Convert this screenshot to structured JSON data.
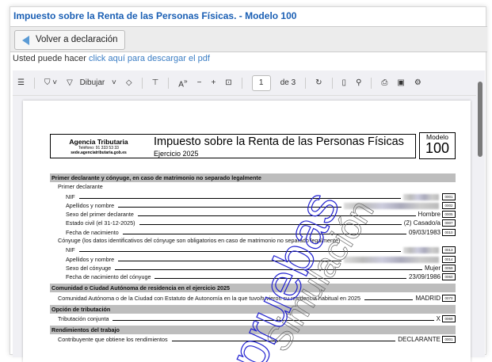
{
  "window": {
    "title": "Impuesto sobre la Renta de las Personas Físicas. - Modelo 100"
  },
  "back_button": "Volver a declaración",
  "download": {
    "prefix": "Usted puede hacer",
    "link": "click aquí para descargar el pdf"
  },
  "toolbar": {
    "draw_label": "Dibujar",
    "page_value": "1",
    "page_total": "de 3"
  },
  "document": {
    "agency": "Agencia Tributaria",
    "phone": "Teléfono: 91 333 53 33",
    "site": "sede.agenciatributaria.gob.es",
    "title": "Impuesto sobre la Renta de las Personas Físicas",
    "exercise": "Ejercicio 2025",
    "model_label": "Modelo",
    "model_number": "100",
    "watermark_gray": "Simulación",
    "watermark_blue": "pruebas",
    "sections": [
      {
        "title": "Primer declarante y cónyuge, en caso de matrimonio no separado legalmente",
        "subs": [
          {
            "title": "Primer declarante",
            "rows": [
              {
                "label": "NIF",
                "value": "",
                "blurred": true,
                "code": "0001"
              },
              {
                "label": "Apellidos y nombre",
                "value": "",
                "blurred": true,
                "code": "0002"
              },
              {
                "label": "Sexo del primer declarante",
                "value": "Hombre",
                "code": "0005"
              },
              {
                "label": "Estado civil (el 31-12-2025)",
                "value": "(2) Casado/a",
                "code": "0007"
              },
              {
                "label": "Fecha de nacimiento",
                "value": "09/03/1983",
                "code": "0010"
              }
            ]
          },
          {
            "title": "Cónyuge (los datos identificativos del cónyuge son obligatorios en caso de matrimonio no separado legalmente)",
            "rows": [
              {
                "label": "NIF",
                "value": "",
                "blurred": true,
                "code": "0013"
              },
              {
                "label": "Apellidos y nombre",
                "value": "",
                "blurred": true,
                "code": "0014"
              },
              {
                "label": "Sexo del cónyuge",
                "value": "Mujer",
                "code": "0059"
              },
              {
                "label": "Fecha de nacimiento del cónyuge",
                "value": "23/09/1986",
                "code": "0060"
              }
            ]
          }
        ]
      },
      {
        "title": "Comunidad o Ciudad Autónoma de residencia en el ejercicio 2025",
        "rows": [
          {
            "label": "Comunidad Autónoma o de la Ciudad con Estatuto de Autonomía en la que tuvo/tuvieron su residencia habitual en 2025",
            "value": "MADRID",
            "code": "0070"
          }
        ]
      },
      {
        "title": "Opción de tributación",
        "rows": [
          {
            "label": "Tributación conjunta",
            "value": "X",
            "code": "0069"
          }
        ]
      },
      {
        "title": "Rendimientos del trabajo",
        "rows": [
          {
            "label": "Contribuyente que obtiene los rendimientos",
            "value": "DECLARANTE",
            "code": "0001"
          }
        ]
      }
    ]
  }
}
